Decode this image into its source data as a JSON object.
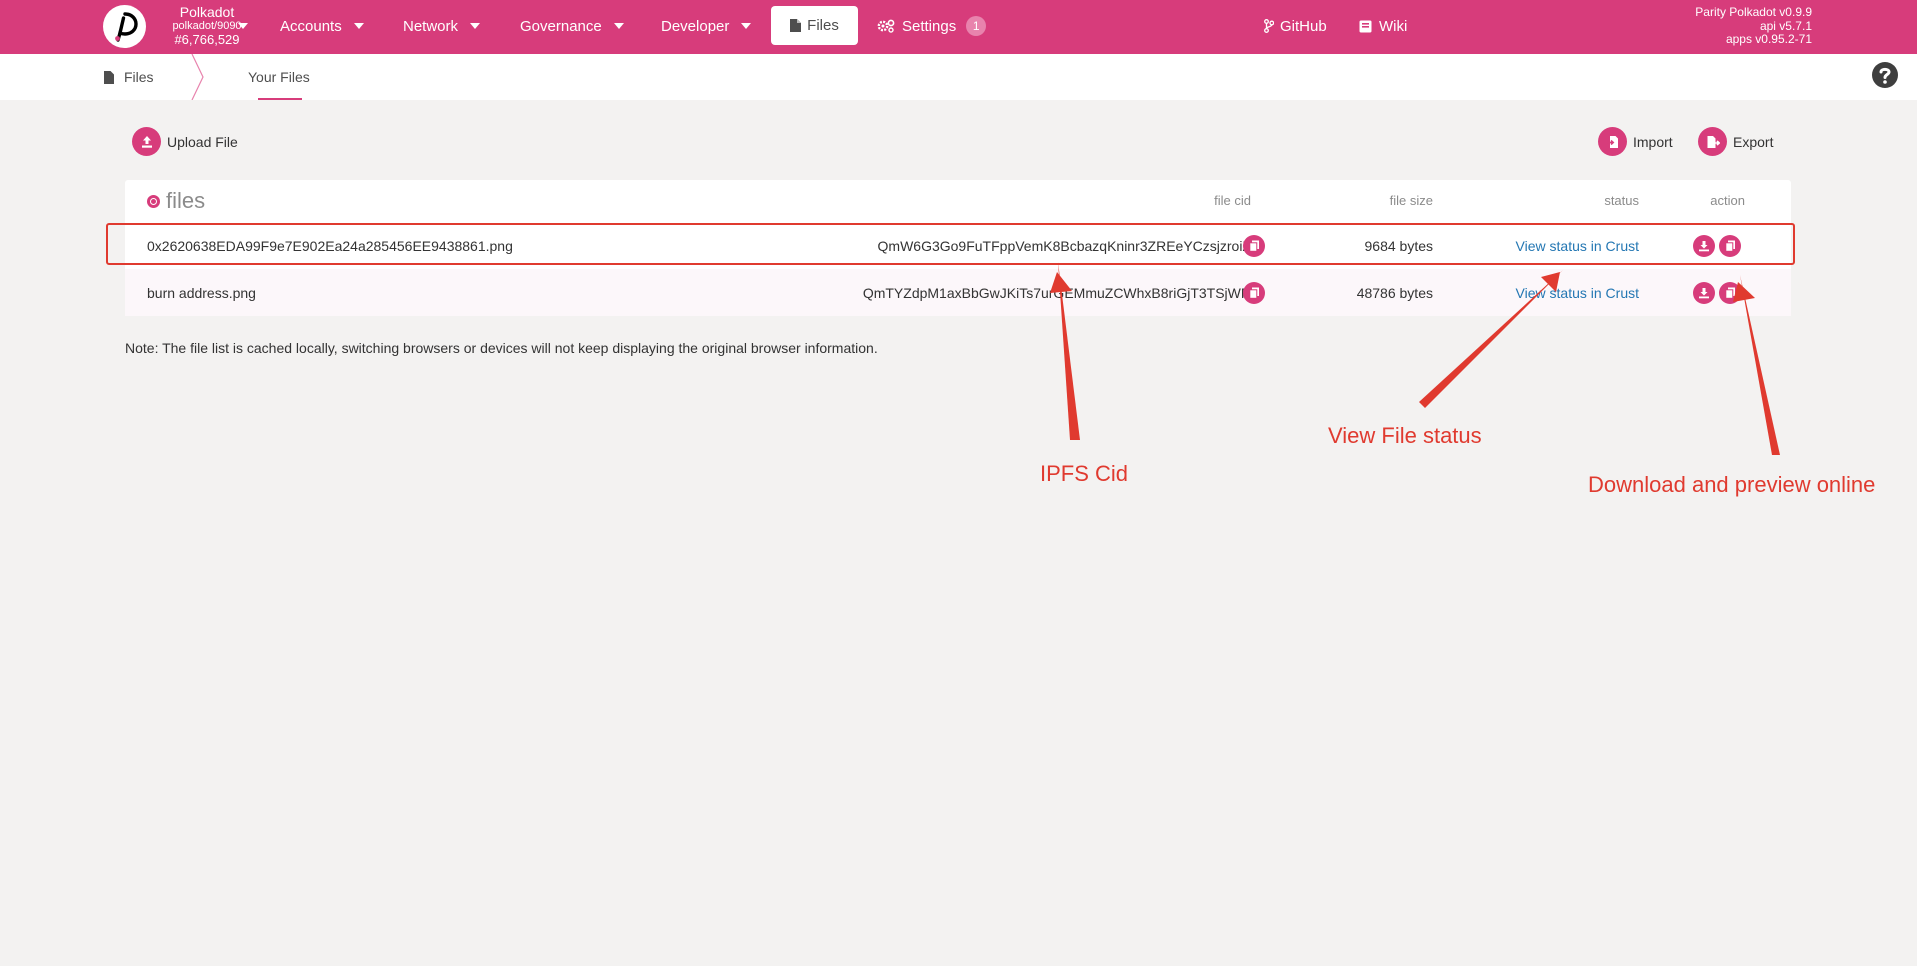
{
  "topbar": {
    "chain_name": "Polkadot",
    "chain_node": "polkadot/9090",
    "block_number": "#6,766,529",
    "nav": [
      {
        "label": "Accounts"
      },
      {
        "label": "Network"
      },
      {
        "label": "Governance"
      },
      {
        "label": "Developer"
      }
    ],
    "files_label": "Files",
    "settings_label": "Settings",
    "settings_badge": "1",
    "github_label": "GitHub",
    "wiki_label": "Wiki",
    "versions": [
      "Parity Polkadot v0.9.9",
      "api v5.7.1",
      "apps v0.95.2-71"
    ]
  },
  "breadcrumb": {
    "root": "Files",
    "current": "Your Files"
  },
  "actions": {
    "upload": "Upload File",
    "import": "Import",
    "export": "Export"
  },
  "table": {
    "title": "files",
    "headers": {
      "cid": "file cid",
      "size": "file size",
      "status": "status",
      "action": "action"
    },
    "rows": [
      {
        "name": "0x2620638EDA99F9e7E902Ea24a285456EE9438861.png",
        "cid": "QmW6G3Go9FuTFppVemK8BcbazqKninr3ZREeYCzsjzroiZ",
        "size": "9684 bytes",
        "status": "View status in Crust"
      },
      {
        "name": "burn address.png",
        "cid": "QmTYZdpM1axBbGwJKiTs7urGEMmuZCWhxB8riGjT3TSjWR",
        "size": "48786 bytes",
        "status": "View status in Crust"
      }
    ]
  },
  "note": "Note: The file list is cached locally, switching browsers or devices will not keep displaying the original browser information.",
  "annotations": {
    "cid_label": "IPFS Cid",
    "status_label": "View File status",
    "download_label": "Download and preview online"
  },
  "colors": {
    "brand": "#d73c7b",
    "link": "#2477b3",
    "annotation": "#e03a2f"
  }
}
